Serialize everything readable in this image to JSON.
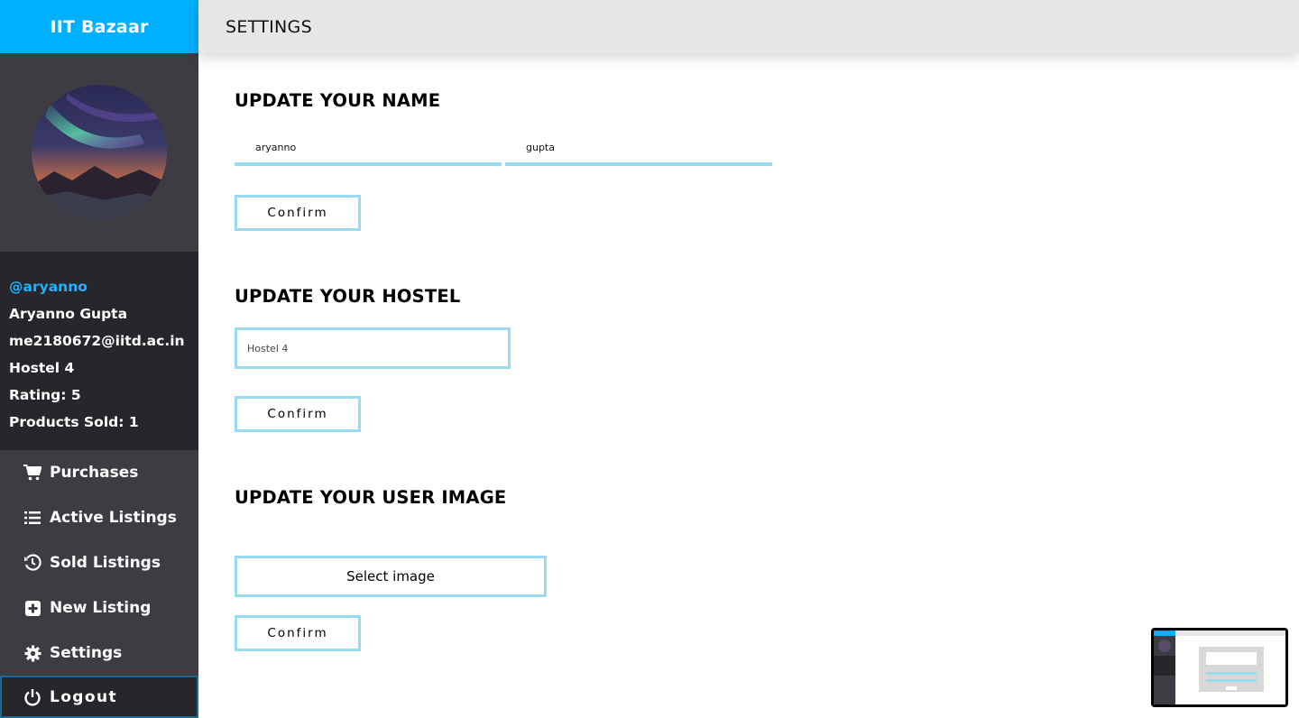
{
  "brand": "IIT Bazaar",
  "header": {
    "title": "SETTINGS"
  },
  "profile": {
    "handle": "@aryanno",
    "name": "Aryanno Gupta",
    "email": "me2180672@iitd.ac.in",
    "hostel": "Hostel 4",
    "rating": "Rating: 5",
    "products_sold": "Products Sold: 1"
  },
  "nav": {
    "items": [
      {
        "label": "Purchases",
        "icon": "cart-icon"
      },
      {
        "label": "Active Listings",
        "icon": "list-icon"
      },
      {
        "label": "Sold Listings",
        "icon": "history-icon"
      },
      {
        "label": "New Listing",
        "icon": "plus-square-icon"
      },
      {
        "label": "Settings",
        "icon": "gear-icon"
      }
    ],
    "logout": {
      "label": "Logout",
      "icon": "power-icon"
    }
  },
  "name_section": {
    "title": "UPDATE YOUR NAME",
    "first_name": "aryanno",
    "last_name": "gupta",
    "confirm_label": "Confirm"
  },
  "hostel_section": {
    "title": "UPDATE YOUR HOSTEL",
    "hostel_value": "Hostel 4",
    "confirm_label": "Confirm"
  },
  "image_section": {
    "title": "UPDATE YOUR USER IMAGE",
    "select_label": "Select image",
    "confirm_label": "Confirm"
  },
  "colors": {
    "accent": "#00b0ff",
    "input_border": "#99dcf2",
    "sidebar": "#3c3c42",
    "sidebar_dark": "#26262b"
  }
}
